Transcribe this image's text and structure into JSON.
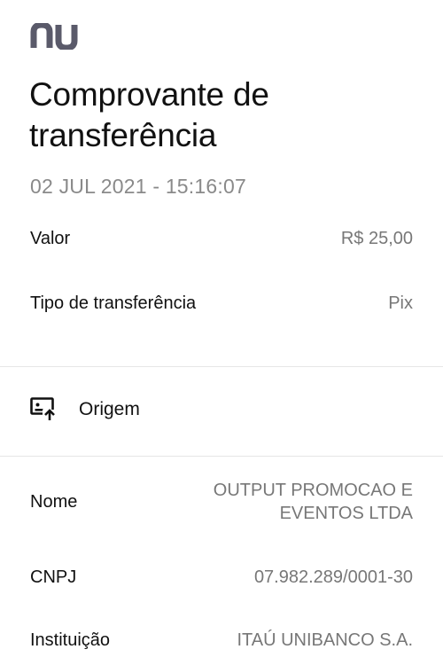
{
  "brand": {
    "logo_text": "nu"
  },
  "receipt": {
    "title": "Comprovante de transferência",
    "datetime": "02 JUL 2021 - 15:16:07"
  },
  "details": {
    "valor": {
      "label": "Valor",
      "value": "R$ 25,00"
    },
    "tipo": {
      "label": "Tipo de transferência",
      "value": "Pix"
    }
  },
  "origem": {
    "icon": "screen-upload-icon",
    "title": "Origem",
    "nome": {
      "label": "Nome",
      "value_line1": "OUTPUT PROMOCAO E",
      "value_line2": "EVENTOS LTDA"
    },
    "cnpj": {
      "label": "CNPJ",
      "value": "07.982.289/0001-30"
    },
    "instituicao": {
      "label": "Instituição",
      "value": "ITAÚ UNIBANCO S.A."
    }
  },
  "colors": {
    "text_primary": "#111111",
    "text_secondary": "#777777",
    "logo": "#5a5a6a",
    "divider": "#e6e6e6"
  }
}
